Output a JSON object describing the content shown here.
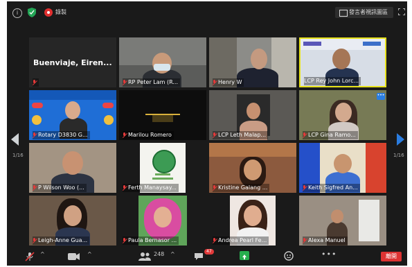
{
  "topbar": {
    "recording_label": "錄製",
    "view_label": "發言者視訊圖區"
  },
  "pagination": {
    "left": "1/16",
    "right": "1/16"
  },
  "tiles": [
    {
      "name": "Buenviaje, Eiren...",
      "label": ""
    },
    {
      "name": "",
      "label": "RP Peter Lam (R..."
    },
    {
      "name": "",
      "label": "Henry W"
    },
    {
      "name": "",
      "label": "LCP Rey John Lorc..."
    },
    {
      "name": "",
      "label": "Rotary D3830 G..."
    },
    {
      "name": "",
      "label": "Marilou Romero"
    },
    {
      "name": "",
      "label": "LCP Leth Malap..."
    },
    {
      "name": "",
      "label": "LCP Gina Ramo..."
    },
    {
      "name": "",
      "label": "P Wilson Woo (..."
    },
    {
      "name": "",
      "label": "Ferth Manaysay..."
    },
    {
      "name": "",
      "label": "Kristine Galang ..."
    },
    {
      "name": "",
      "label": "Keith Sigfred An..."
    },
    {
      "name": "",
      "label": "Leigh-Anne Gua..."
    },
    {
      "name": "",
      "label": "Paula Bernasor ..."
    },
    {
      "name": "",
      "label": "Andrea Pearl Fe..."
    },
    {
      "name": "",
      "label": "Alexa Manuel"
    }
  ],
  "bottombar": {
    "participants_count": "248",
    "chat_badge": "47",
    "leave_label": "離開"
  }
}
